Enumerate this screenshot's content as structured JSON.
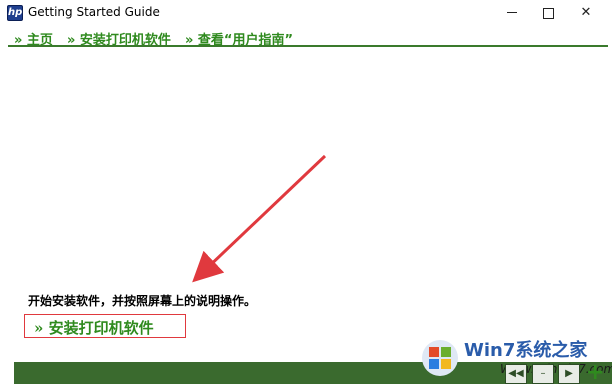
{
  "window": {
    "title": "Getting Started Guide"
  },
  "nav": {
    "items": [
      "» 主页",
      "» 安装打印机软件",
      "» 查看“用户指南”"
    ]
  },
  "content": {
    "instruction": "开始安装软件，并按照屏幕上的说明操作。",
    "install_link": "» 安装打印机软件"
  },
  "footer": {
    "back_label": "◀◀",
    "mid_label": "–",
    "fwd_label": "▶",
    "plus_label": "+"
  },
  "watermark": {
    "brand": "Win7系统之家",
    "url": "Www.Winwin7.com"
  },
  "colors": {
    "accent_green": "#2f8a1e",
    "bar_green": "#3a6a2e",
    "highlight_red": "#e0393e"
  }
}
